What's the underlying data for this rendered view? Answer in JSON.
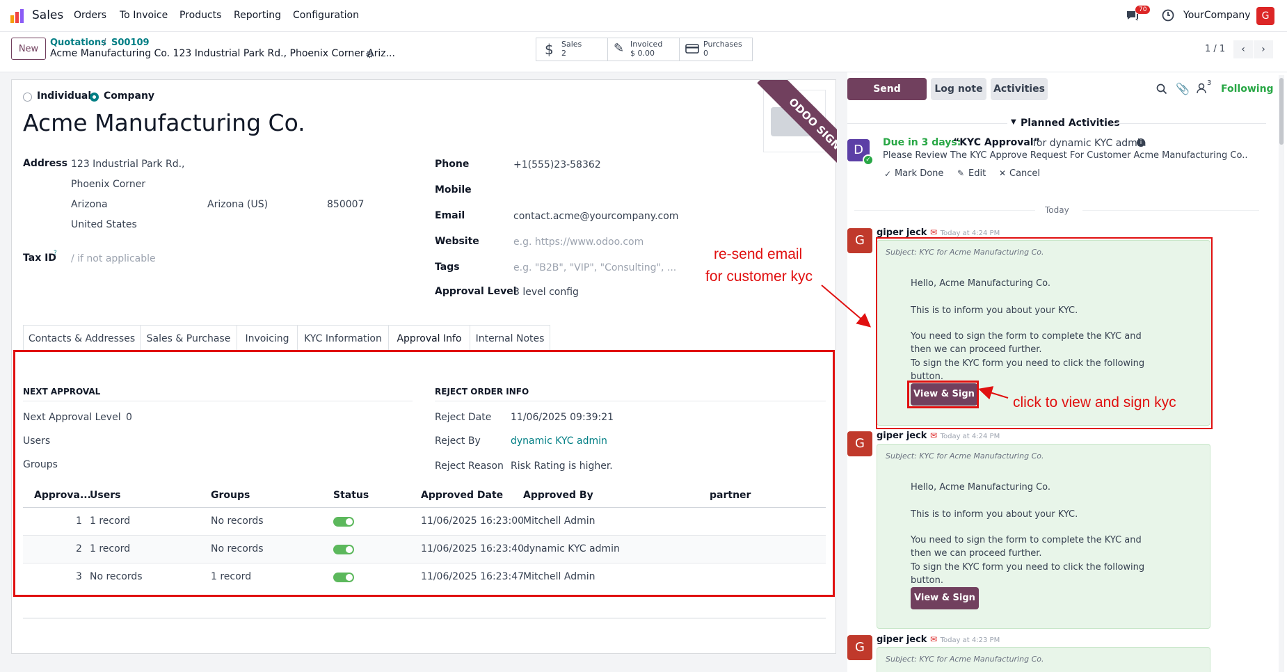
{
  "navbar": {
    "app_name": "Sales",
    "menu": [
      "Orders",
      "To Invoice",
      "Products",
      "Reporting",
      "Configuration"
    ],
    "chat_badge": "70",
    "company": "YourCompany",
    "user_initial": "G"
  },
  "control_panel": {
    "new_button": "New",
    "breadcrumb_parent": "Quotations",
    "breadcrumb_sep": "/",
    "breadcrumb_current": "S00109",
    "record_title": "Acme Manufacturing Co. 123 Industrial Park Rd., Phoenix Corner Ariz...",
    "stats": [
      {
        "label": "Sales",
        "value": "2"
      },
      {
        "label": "Invoiced",
        "value": "$ 0.00"
      },
      {
        "label": "Purchases",
        "value": "0"
      }
    ],
    "pager": "1 / 1"
  },
  "form": {
    "company_type_options": [
      "Individual",
      "Company"
    ],
    "selected_type": "Company",
    "name": "Acme Manufacturing Co.",
    "ribbon": "ODOO SIGN",
    "address_label": "Address",
    "street": "123 Industrial Park Rd.,",
    "street2": "Phoenix Corner",
    "city": "Arizona",
    "state": "Arizona (US)",
    "zip": "850007",
    "country": "United States",
    "tax_label": "Tax ID",
    "tax_sup": "?",
    "tax_placeholder": "/ if not applicable",
    "phone_label": "Phone",
    "phone": "+1(555)23-58362",
    "mobile_label": "Mobile",
    "email_label": "Email",
    "email": "contact.acme@yourcompany.com",
    "website_label": "Website",
    "website_placeholder": "e.g. https://www.odoo.com",
    "tags_label": "Tags",
    "tags_placeholder": "e.g. \"B2B\", \"VIP\", \"Consulting\", ...",
    "approval_level_label": "Approval Level",
    "approval_level": "3 level config"
  },
  "tabs": [
    "Contacts & Addresses",
    "Sales & Purchase",
    "Invoicing",
    "KYC Information",
    "Approval Info",
    "Internal Notes"
  ],
  "active_tab": "Approval Info",
  "approval": {
    "next_title": "NEXT APPROVAL",
    "next_level_label": "Next Approval Level",
    "next_level": "0",
    "users_label": "Users",
    "groups_label": "Groups",
    "reject_title": "REJECT ORDER INFO",
    "reject_date_label": "Reject Date",
    "reject_date": "11/06/2025 09:39:21",
    "reject_by_label": "Reject By",
    "reject_by": "dynamic KYC admin",
    "reject_reason_label": "Reject Reason",
    "reject_reason": "Risk Rating is higher.",
    "columns": [
      "Approva...",
      "Users",
      "Groups",
      "Status",
      "Approved Date",
      "Approved By",
      "partner"
    ],
    "rows": [
      {
        "level": "1",
        "users": "1 record",
        "groups": "No records",
        "status": true,
        "date": "11/06/2025 16:23:00",
        "by": "Mitchell Admin",
        "partner": ""
      },
      {
        "level": "2",
        "users": "1 record",
        "groups": "No records",
        "status": true,
        "date": "11/06/2025 16:23:40",
        "by": "dynamic KYC admin",
        "partner": ""
      },
      {
        "level": "3",
        "users": "No records",
        "groups": "1 record",
        "status": true,
        "date": "11/06/2025 16:23:47",
        "by": "Mitchell Admin",
        "partner": ""
      }
    ]
  },
  "chatter": {
    "send_message": "Send message",
    "log_note": "Log note",
    "activities": "Activities",
    "followers_count": "3",
    "following": "Following",
    "planned_title": "Planned Activities",
    "activity_avatar": "D",
    "due": "Due in 3 days:",
    "activity_name": "“KYC Approval”",
    "activity_for": "for dynamic KYC admin",
    "activity_note": "Please Review The KYC Approve Request For Customer Acme Manufacturing Co..",
    "mark_done": "Mark Done",
    "edit": "Edit",
    "cancel": "Cancel",
    "today": "Today",
    "messages": [
      {
        "avatar": "G",
        "author": "giper jeck",
        "time": "Today at 4:24 PM",
        "subject": "Subject: KYC for Acme Manufacturing Co.",
        "greeting": "Hello, Acme Manufacturing Co.",
        "line1": "This is to inform you about your KYC.",
        "line2": "You need to sign the form to complete the KYC and then we can proceed further.",
        "line3": "To sign the KYC form you need to click the following button.",
        "button": "View & Sign"
      },
      {
        "avatar": "G",
        "author": "giper jeck",
        "time": "Today at 4:24 PM",
        "subject": "Subject: KYC for Acme Manufacturing Co.",
        "greeting": "Hello, Acme Manufacturing Co.",
        "line1": "This is to inform you about your KYC.",
        "line2": "You need to sign the form to complete the KYC and then we can proceed further.",
        "line3": "To sign the KYC form you need to click the following button.",
        "button": "View & Sign"
      },
      {
        "avatar": "G",
        "author": "giper jeck",
        "time": "Today at 4:23 PM",
        "subject": "Subject: KYC for Acme Manufacturing Co."
      }
    ]
  },
  "annotations": {
    "resend_line1": "re-send email",
    "resend_line2": "for customer kyc",
    "click_sign": "click to view and sign kyc",
    "color": "#e01010"
  },
  "colors": {
    "brand": "#71405e",
    "link": "#017e84",
    "success": "#28a745",
    "highlight": "#e01010"
  }
}
